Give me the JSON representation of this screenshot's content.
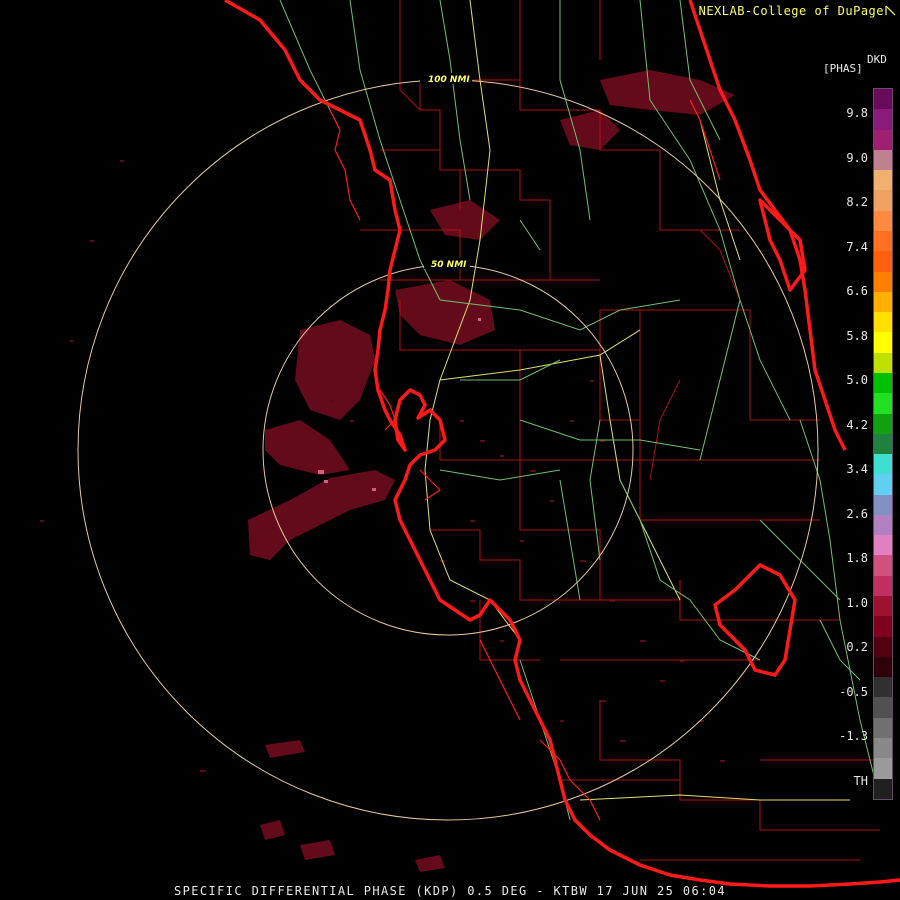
{
  "credit": "NEXLAB-College of DuPage",
  "credit_icon": "arrow-icon",
  "product_code": "DKD",
  "units": "[PHAS]",
  "rings": {
    "inner_label": "50 NMI",
    "outer_label": "100 NMI"
  },
  "footer": "SPECIFIC DIFFERENTIAL PHASE (KDP) 0.5 DEG - KTBW 17 JUN 25 06:04",
  "scale": {
    "labels": [
      "9.8",
      "9.0",
      "8.2",
      "7.4",
      "6.6",
      "5.8",
      "5.0",
      "4.2",
      "3.4",
      "2.6",
      "1.8",
      "1.0",
      "0.2",
      "-0.5",
      "-1.3",
      "TH"
    ],
    "colors": [
      "#6a0a5a",
      "#8a1a7a",
      "#a02070",
      "#c08090",
      "#f0b070",
      "#f0a060",
      "#ff8a40",
      "#ff7020",
      "#ff6010",
      "#ff8000",
      "#ffb000",
      "#ffe000",
      "#ffff00",
      "#c0e000",
      "#00c000",
      "#20e020",
      "#10a010",
      "#208040",
      "#40e0d0",
      "#60d0f0",
      "#8090c0",
      "#b080c0",
      "#e080c0",
      "#d05080",
      "#c03060",
      "#a01030",
      "#800020",
      "#500010",
      "#300008",
      "#303030",
      "#505050",
      "#707070",
      "#888888",
      "#9a9a9a",
      "#202020"
    ]
  },
  "colors": {
    "coast": "#ff1a1a",
    "county": "#b01010",
    "roads_yellow": "#e0e070",
    "roads_green": "#70c070",
    "ring": "#e8c8a0",
    "echo": "#7a1020"
  }
}
